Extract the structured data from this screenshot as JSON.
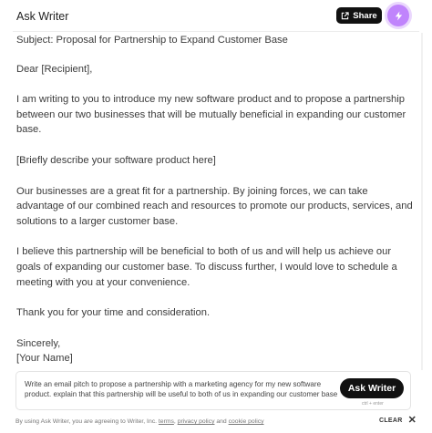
{
  "header": {
    "title": "Ask Writer",
    "share_label": "Share",
    "share_icon": "external-share-icon",
    "bolt_icon": "lightning-bolt-icon",
    "accent_color": "#c084fc"
  },
  "letter": {
    "subject": "Subject: Proposal for Partnership to Expand Customer Base",
    "greeting": "Dear [Recipient],",
    "paragraphs": [
      "I am writing to you to introduce my new software product and to propose a partnership between our two businesses that will be mutually beneficial in expanding our customer base.",
      "[Briefly describe your software product here]",
      "Our businesses are a great fit for a partnership. By joining forces, we can take advantage of our combined reach and resources to promote our products, services, and solutions to a larger customer base.",
      "I believe this partnership will be beneficial to both of us and will help us achieve our goals of expanding our customer base. To discuss further, I would love to schedule a meeting with you at your convenience.",
      "Thank you for your time and consideration."
    ],
    "closing": "Sincerely,",
    "signature": "[Your Name]"
  },
  "prompt": {
    "text": "Write an email pitch to propose a partnership with a marketing agency for my new software product. explain that this partnership will be useful to both of us in expanding our customer base",
    "button_label": "Ask Writer",
    "shortcut_hint": "ctrl + enter"
  },
  "footer": {
    "prefix": "By using Ask Writer, you are agreeing to Writer, Inc.",
    "terms": "terms",
    "separator": ",",
    "privacy": "privacy policy",
    "and": "and",
    "cookie": "cookie policy",
    "clear_label": "CLEAR",
    "clear_icon": "close-icon"
  }
}
